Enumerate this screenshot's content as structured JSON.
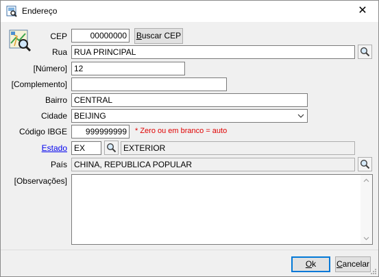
{
  "window": {
    "title": "Endereço",
    "close_glyph": "✕"
  },
  "labels": {
    "cep": "CEP",
    "rua": "Rua",
    "numero": "[Número]",
    "complemento": "[Complemento]",
    "bairro": "Bairro",
    "cidade": "Cidade",
    "codigo_ibge": "Código IBGE",
    "estado": "Estado",
    "pais": "País",
    "observacoes": "[Observações]"
  },
  "fields": {
    "cep": "00000000",
    "rua": "RUA PRINCIPAL",
    "numero": "12",
    "complemento": "",
    "bairro": "CENTRAL",
    "cidade": "BEIJING",
    "codigo_ibge": "999999999",
    "estado_uf": "EX",
    "estado_nome": "EXTERIOR",
    "pais": "CHINA, REPUBLICA POPULAR",
    "observacoes": ""
  },
  "hints": {
    "ibge": "* Zero ou em branco = auto"
  },
  "buttons": {
    "buscar_cep": "Buscar CEP",
    "buscar_cep_accel": "B",
    "buscar_cep_rest": "uscar CEP",
    "ok_accel": "O",
    "ok_rest": "k",
    "cancelar_accel": "C",
    "cancelar_rest": "ancelar"
  },
  "icons": {
    "title": "address-book-icon",
    "side": "map-search-icon",
    "lookup": "search-magnifier-icon"
  },
  "colors": {
    "hint": "#e00000",
    "link": "#0000ee",
    "focus": "#0078d7"
  }
}
